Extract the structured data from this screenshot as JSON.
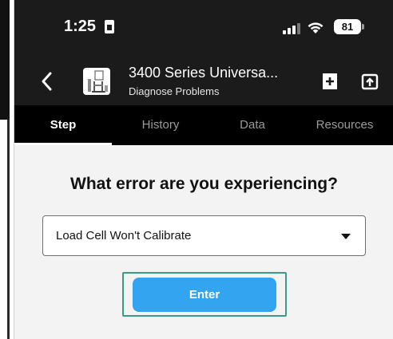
{
  "status_bar": {
    "time": "1:25",
    "battery": "81"
  },
  "header": {
    "title": "3400 Series Universa...",
    "subtitle": "Diagnose Problems",
    "icons": [
      "back-icon",
      "instron-machine-thumbnail",
      "add-note-icon",
      "share-icon"
    ]
  },
  "tabs": [
    {
      "label": "Step",
      "active": true
    },
    {
      "label": "History",
      "active": false
    },
    {
      "label": "Data",
      "active": false
    },
    {
      "label": "Resources",
      "active": false
    }
  ],
  "main": {
    "question": "What error are you experiencing?",
    "error_select": {
      "value": "Load Cell Won't Calibrate"
    },
    "enter_label": "Enter"
  },
  "colors": {
    "dark_bar": "#1b1b1b",
    "tab_bar": "#000000",
    "accent_button": "#33a4f0",
    "highlight_border": "#3e9a84",
    "content_bg": "#f3f3f3"
  }
}
